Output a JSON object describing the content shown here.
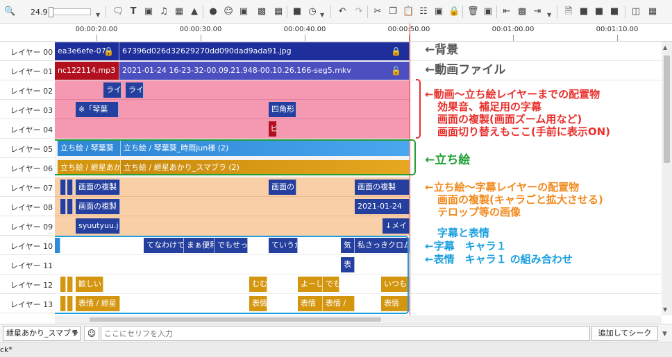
{
  "toolbar": {
    "zoom_value": "24.9",
    "icons": [
      "zoom-icon",
      "comment-icon",
      "text-icon",
      "video-icon",
      "music-icon",
      "image-icon",
      "shape-icon",
      "person-icon",
      "face-icon",
      "picture-icon",
      "image-add-icon",
      "grid-icon",
      "save-icon",
      "clock-icon",
      "undo-icon",
      "redo-icon",
      "cut-icon",
      "copy-icon",
      "paste-icon",
      "export-icon",
      "frame-icon",
      "lock-icon",
      "delete-icon",
      "delete-all-icon",
      "split-left-icon",
      "split-icon",
      "split-right-icon",
      "file-new-icon",
      "file-add-icon",
      "folder-icon",
      "save-as-icon",
      "layout-icon",
      "more-icon"
    ]
  },
  "ruler": {
    "ticks": [
      {
        "label": "00:00:20.00"
      },
      {
        "label": "00:00:30.00"
      },
      {
        "label": "00:00:40.00"
      },
      {
        "label": "00:00:50.00"
      },
      {
        "label": "00:01:00.00"
      },
      {
        "label": "00:01:10.00"
      }
    ]
  },
  "layers": [
    {
      "label": "レイヤー 00"
    },
    {
      "label": "レイヤー 01"
    },
    {
      "label": "レイヤー 02"
    },
    {
      "label": "レイヤー 03"
    },
    {
      "label": "レイヤー 04"
    },
    {
      "label": "レイヤー 05"
    },
    {
      "label": "レイヤー 06"
    },
    {
      "label": "レイヤー 07"
    },
    {
      "label": "レイヤー 08"
    },
    {
      "label": "レイヤー 09"
    },
    {
      "label": "レイヤー 10"
    },
    {
      "label": "レイヤー 11"
    },
    {
      "label": "レイヤー 12"
    },
    {
      "label": "レイヤー 13"
    }
  ],
  "clips": {
    "bg_a": "ea3e6efe-07",
    "bg_b": "67396d026d32629270dd090dad9ada91.jpg",
    "mp3": "nc122114.mp3",
    "mkv": "2021-01-24 16-23-32-00.09.21.948-00.10.26.166-seg5.mkv",
    "l2_a": "ライ",
    "l2_b": "ライ",
    "l3_a": "※「琴葉",
    "l3_b": "四角形",
    "l4_a": "ヒ",
    "l5_a": "立ち絵 / 琴葉葵",
    "l5_b": "立ち絵 / 琴葉葵_時雨jun様 (2)",
    "l6_a": "立ち絵 / 紲星あか",
    "l6_b": "立ち絵 / 紲星あかり_スマブラ (2)",
    "l7_a": "画面の複製",
    "l7_b": "画面の",
    "l7_c": "画面の複製",
    "l8_a": "画面の複製",
    "l8_b": "2021-01-24",
    "l9_a": "syuutyuu.j",
    "l9_b": "↓メイ",
    "l10_a": "てなわけで",
    "l10_b": "まぁ便利",
    "l10_c": "でもせっ",
    "l10_d": "ていうか",
    "l10_e": "気",
    "l10_f": "私さっきクロム",
    "l11_a": "表",
    "l12_a": "歓しい",
    "l12_b": "むむ",
    "l12_c": "よーし",
    "l12_d": "でも",
    "l12_e": "いつも",
    "l13_a": "表情 / 紲星",
    "l13_b": "表情",
    "l13_c": "表情",
    "l13_d": "表情 /",
    "l13_e": "表情"
  },
  "annotations": {
    "bg": "←背景",
    "video_file": "←動画ファイル",
    "red_1": "←動画～立ち絵レイヤーまでの配置物",
    "red_2": "効果音、補足用の字幕",
    "red_3": "画面の複製(画面ズーム用など)",
    "red_4": "画面切り替えもここ(手前に表示ON)",
    "green_1": "←立ち絵",
    "orange_1": "←立ち絵～字幕レイヤーの配置物",
    "orange_2": "画面の複製(キャラごと拡大させる)",
    "orange_3": "テロップ等の画像",
    "blue_1": "字幕と表情",
    "blue_2": "←字幕　キャラ１",
    "blue_3": "←表情　キャラ１ の組み合わせ"
  },
  "colors": {
    "pink": "#f598b2",
    "peach": "#f9cfa8",
    "navy": "#1e2f9c",
    "blue_clip": "#2f88d8",
    "gold_clip": "#d5960f",
    "dark_red": "#b2101e",
    "red_note": "#e8302c",
    "green_note": "#22a035",
    "orange_note": "#f28a1d",
    "blue_note": "#1b9fe0"
  },
  "bottom": {
    "character": "紲星あかり_スマブラ",
    "serif_placeholder": "ここにセリフを入力",
    "add_button": "追加してシーク",
    "status": "ck*"
  }
}
